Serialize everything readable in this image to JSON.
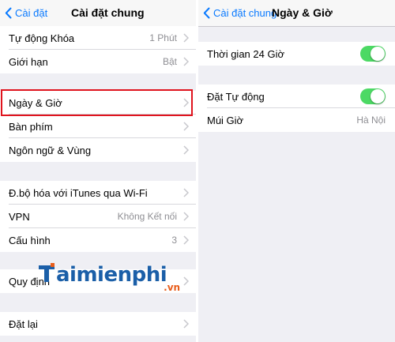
{
  "left": {
    "back_label": "Cài đặt",
    "title": "Cài đặt chung",
    "groups": [
      [
        {
          "label": "Tự động Khóa",
          "value": "1 Phút"
        },
        {
          "label": "Giới hạn",
          "value": "Bật"
        }
      ],
      [
        {
          "label": "Ngày & Giờ",
          "value": ""
        },
        {
          "label": "Bàn phím",
          "value": ""
        },
        {
          "label": "Ngôn ngữ & Vùng",
          "value": ""
        }
      ],
      [
        {
          "label": "Đ.bộ hóa với iTunes qua Wi-Fi",
          "value": ""
        },
        {
          "label": "VPN",
          "value": "Không Kết nối"
        },
        {
          "label": "Cấu hình",
          "value": "3"
        }
      ],
      [
        {
          "label": "Quy định",
          "value": ""
        }
      ],
      [
        {
          "label": "Đặt lại",
          "value": ""
        }
      ]
    ]
  },
  "right": {
    "back_label": "Cài đặt chung",
    "title": "Ngày & Giờ",
    "groups": [
      [
        {
          "label": "Thời gian 24 Giờ",
          "toggle": true
        }
      ],
      [
        {
          "label": "Đặt Tự động",
          "toggle": true
        },
        {
          "label": "Múi Giờ",
          "value": "Hà Nội"
        }
      ]
    ]
  },
  "watermark": {
    "main": "aimienphi",
    "sub": ".vn"
  },
  "colors": {
    "accent": "#0a7aff",
    "toggle_on": "#4cd964",
    "highlight": "#e0141e",
    "background": "#efeff4"
  }
}
